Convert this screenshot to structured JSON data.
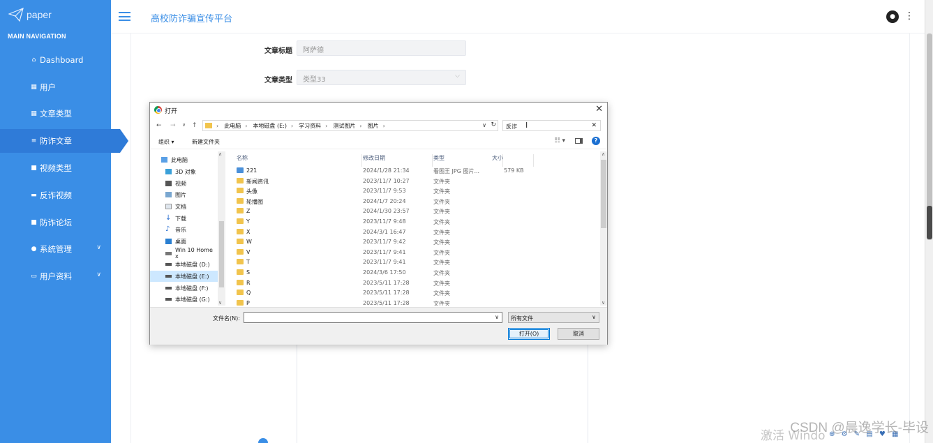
{
  "sidebar": {
    "logo_text": "paper",
    "nav_title": "MAIN NAVIGATION",
    "items": [
      {
        "label": "Dashboard",
        "icon": "home-icon"
      },
      {
        "label": "用户",
        "icon": "grid-icon"
      },
      {
        "label": "文章类型",
        "icon": "grid-icon"
      },
      {
        "label": "防诈文章",
        "icon": "list-icon",
        "active": true
      },
      {
        "label": "视频类型",
        "icon": "square-icon"
      },
      {
        "label": "反诈视频",
        "icon": "briefcase-icon"
      },
      {
        "label": "防诈论坛",
        "icon": "square-icon"
      },
      {
        "label": "系统管理",
        "icon": "pin-icon",
        "expandable": true
      },
      {
        "label": "用户资料",
        "icon": "card-icon",
        "expandable": true
      }
    ],
    "accent_color": "#3a8ee6"
  },
  "header": {
    "title": "高校防诈骗宣传平台"
  },
  "form": {
    "title_label": "文章标题",
    "title_value": "阿萨德",
    "type_label": "文章类型",
    "type_value": "类型33"
  },
  "dialog": {
    "title": "打开",
    "breadcrumb": [
      "此电脑",
      "本地磁盘 (E:)",
      "学习资料",
      "测试图片",
      "图片"
    ],
    "search_value": "反诈",
    "toolbar": {
      "organize": "组织 ▾",
      "new_folder": "新建文件夹"
    },
    "tree": [
      {
        "label": "此电脑",
        "icon": "computer-icon"
      },
      {
        "label": "3D 对象",
        "icon": "cube-icon"
      },
      {
        "label": "视频",
        "icon": "video-icon"
      },
      {
        "label": "图片",
        "icon": "picture-icon"
      },
      {
        "label": "文档",
        "icon": "document-icon"
      },
      {
        "label": "下载",
        "icon": "download-icon"
      },
      {
        "label": "音乐",
        "icon": "music-icon"
      },
      {
        "label": "桌面",
        "icon": "desktop-icon"
      },
      {
        "label": "Win 10 Home x",
        "icon": "drive-icon"
      },
      {
        "label": "本地磁盘 (D:)",
        "icon": "drive-icon"
      },
      {
        "label": "本地磁盘 (E:)",
        "icon": "drive-icon",
        "selected": true
      },
      {
        "label": "本地磁盘 (F:)",
        "icon": "drive-icon"
      },
      {
        "label": "本地磁盘 (G:)",
        "icon": "drive-icon"
      }
    ],
    "columns": {
      "name": "名称",
      "date": "修改日期",
      "type": "类型",
      "size": "大小"
    },
    "files": [
      {
        "name": "221",
        "date": "2024/1/28 21:34",
        "type": "看图王 JPG 图片...",
        "size": "579 KB",
        "kind": "image"
      },
      {
        "name": "新闻资讯",
        "date": "2023/11/7 10:27",
        "type": "文件夹",
        "size": "",
        "kind": "folder"
      },
      {
        "name": "头像",
        "date": "2023/11/7 9:53",
        "type": "文件夹",
        "size": "",
        "kind": "folder"
      },
      {
        "name": "轮播图",
        "date": "2024/1/7 20:24",
        "type": "文件夹",
        "size": "",
        "kind": "folder"
      },
      {
        "name": "Z",
        "date": "2024/1/30 23:57",
        "type": "文件夹",
        "size": "",
        "kind": "folder"
      },
      {
        "name": "Y",
        "date": "2023/11/7 9:48",
        "type": "文件夹",
        "size": "",
        "kind": "folder"
      },
      {
        "name": "X",
        "date": "2024/3/1 16:47",
        "type": "文件夹",
        "size": "",
        "kind": "folder"
      },
      {
        "name": "W",
        "date": "2023/11/7 9:42",
        "type": "文件夹",
        "size": "",
        "kind": "folder"
      },
      {
        "name": "V",
        "date": "2023/11/7 9:41",
        "type": "文件夹",
        "size": "",
        "kind": "folder"
      },
      {
        "name": "T",
        "date": "2023/11/7 9:41",
        "type": "文件夹",
        "size": "",
        "kind": "folder"
      },
      {
        "name": "S",
        "date": "2024/3/6 17:50",
        "type": "文件夹",
        "size": "",
        "kind": "folder"
      },
      {
        "name": "R",
        "date": "2023/5/11 17:28",
        "type": "文件夹",
        "size": "",
        "kind": "folder"
      },
      {
        "name": "Q",
        "date": "2023/5/11 17:28",
        "type": "文件夹",
        "size": "",
        "kind": "folder"
      },
      {
        "name": "P",
        "date": "2023/5/11 17:28",
        "type": "文件夹",
        "size": "",
        "kind": "folder"
      }
    ],
    "filename_label": "文件名(N):",
    "filename_value": "",
    "filetype_value": "所有文件",
    "open_button": "打开(O)",
    "cancel_button": "取消"
  },
  "watermark": {
    "csdn": "CSDN @晨逸学长-毕设",
    "activate": "激活 Windo"
  }
}
